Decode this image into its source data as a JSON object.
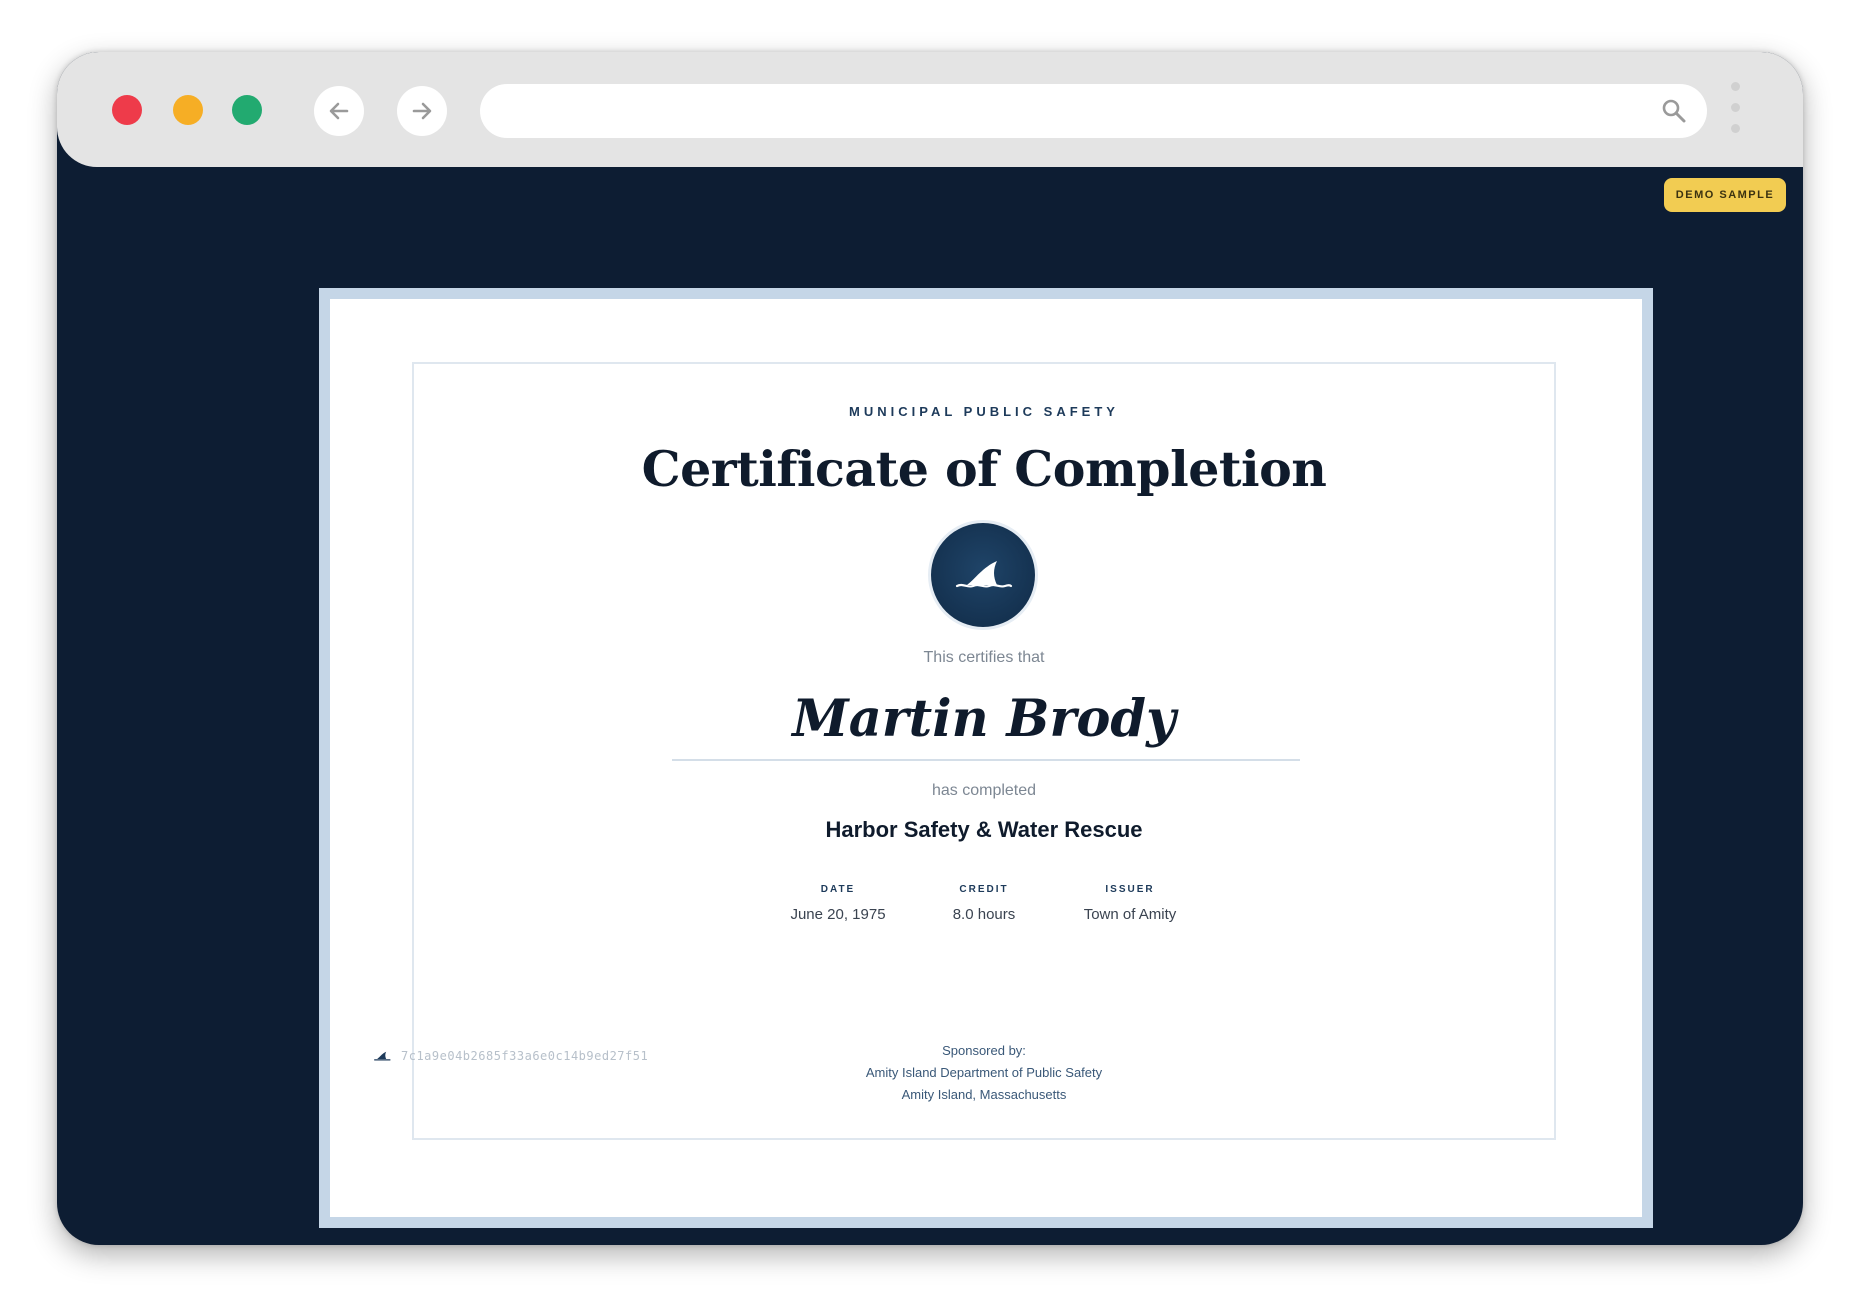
{
  "browser": {
    "url": "",
    "demo_badge": "DEMO SAMPLE"
  },
  "certificate": {
    "organization": "MUNICIPAL PUBLIC SAFETY",
    "title": "Certificate of Completion",
    "certifies_text": "This certifies that",
    "recipient_name": "Martin Brody",
    "completed_text": "has completed",
    "course": "Harbor Safety & Water Rescue",
    "details": [
      {
        "label": "DATE",
        "value": "June 20, 1975"
      },
      {
        "label": "CREDIT",
        "value": "8.0 hours"
      },
      {
        "label": "ISSUER",
        "value": "Town of Amity"
      }
    ],
    "sponsor": {
      "heading": "Sponsored by:",
      "name": "Amity Island Department of Public Safety",
      "location": "Amity Island, Massachusetts"
    },
    "verification_hash": "7c1a9e04b2685f33a6e0c14b9ed27f51"
  },
  "icons": {
    "seal": "shark-fin-icon",
    "footer": "shark-fin-icon",
    "search": "search-icon"
  },
  "colors": {
    "page_background": "#0d1d33",
    "badge": "#f2cc52",
    "accent": "#1d3a5a"
  }
}
